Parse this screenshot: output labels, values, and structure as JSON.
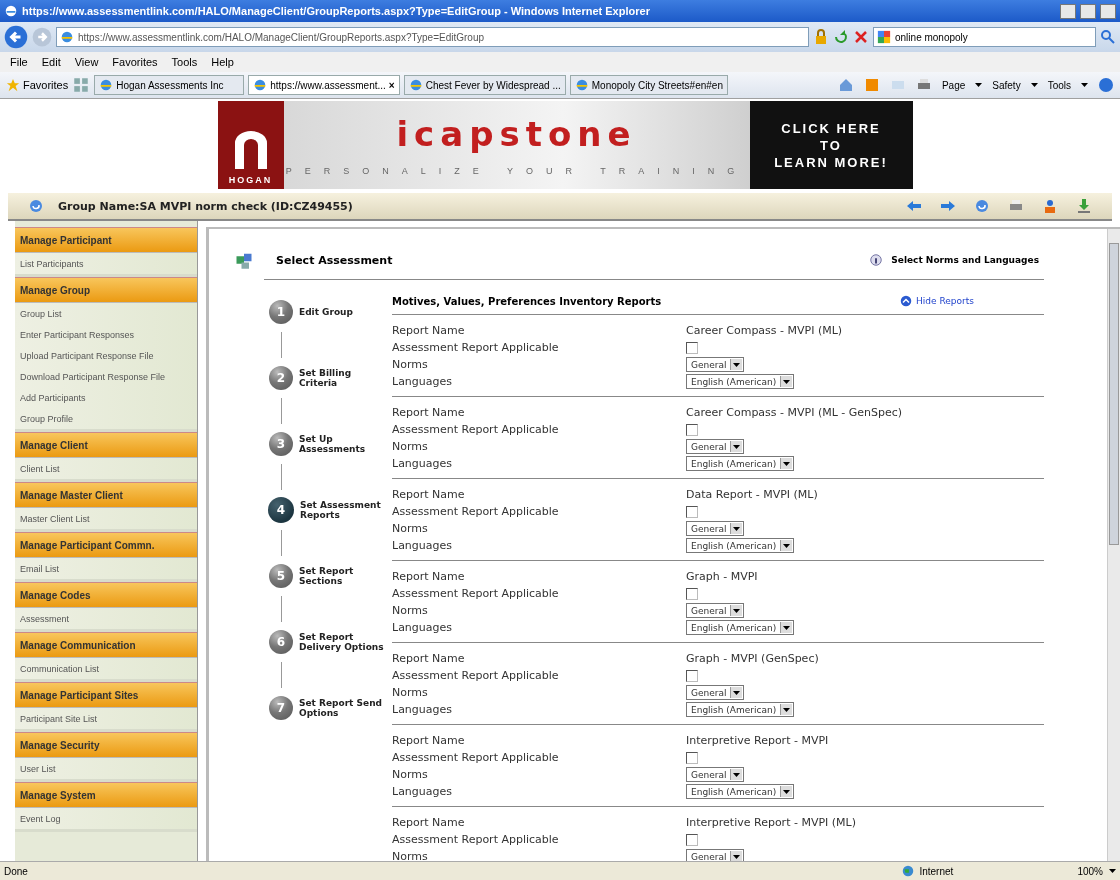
{
  "browser": {
    "title": "https://www.assessmentlink.com/HALO/ManageClient/GroupReports.aspx?Type=EditGroup - Windows Internet Explorer",
    "address": "https://www.assessmentlink.com/HALO/ManageClient/GroupReports.aspx?Type=EditGroup",
    "search": "online monopoly",
    "menu": [
      "File",
      "Edit",
      "View",
      "Favorites",
      "Tools",
      "Help"
    ],
    "favorites": "Favorites",
    "tabs": [
      {
        "label": "Hogan Assessments Inc",
        "selected": false
      },
      {
        "label": "https://www.assessment...",
        "selected": true,
        "close": "×"
      },
      {
        "label": "Chest Fever by Widespread ...",
        "selected": false
      },
      {
        "label": "Monopoly City Streets#en#en",
        "selected": false
      }
    ],
    "command_bar": [
      "Page",
      "Safety",
      "Tools"
    ],
    "status": "Done",
    "zone": "Internet",
    "zoom": "100%"
  },
  "banner": {
    "logo": "HOGAN",
    "title": "icapstone",
    "tagline": "PERSONALIZE YOUR TRAINING",
    "cta": [
      "CLICK HERE",
      "TO",
      "LEARN MORE!"
    ]
  },
  "group_bar": {
    "title": "Group Name:SA MVPI norm check (ID:CZ49455)"
  },
  "sidebar": {
    "sections": [
      {
        "title": "Manage Participant",
        "items": [
          "List Participants"
        ]
      },
      {
        "title": "Manage Group",
        "items": [
          "Group List",
          "Enter Participant Responses",
          "Upload Participant Response File",
          "Download Participant Response File",
          "Add Participants",
          "Group Profile"
        ]
      },
      {
        "title": "Manage Client",
        "items": [
          "Client List"
        ]
      },
      {
        "title": "Manage Master Client",
        "items": [
          "Master Client List"
        ]
      },
      {
        "title": "Manage Participant Commn.",
        "items": [
          "Email List"
        ]
      },
      {
        "title": "Manage Codes",
        "items": [
          "Assessment"
        ]
      },
      {
        "title": "Manage Communication",
        "items": [
          "Communication List"
        ]
      },
      {
        "title": "Manage Participant Sites",
        "items": [
          "Participant Site List"
        ]
      },
      {
        "title": "Manage Security",
        "items": [
          "User List"
        ]
      },
      {
        "title": "Manage System",
        "items": [
          "Event Log"
        ]
      }
    ]
  },
  "content": {
    "title": "Select Assessment",
    "help_link": "Select Norms and Languages",
    "steps": [
      {
        "number": "1",
        "label": "Edit Group",
        "selected": false
      },
      {
        "number": "2",
        "label": "Set Billing\nCriteria",
        "selected": false
      },
      {
        "number": "3",
        "label": "Set Up\nAssessments",
        "selected": false
      },
      {
        "number": "4",
        "label": "Set Assessment\nReports",
        "selected": true
      },
      {
        "number": "5",
        "label": "Set Report\nSections",
        "selected": false
      },
      {
        "number": "6",
        "label": "Set Report\nDelivery Options",
        "selected": false
      },
      {
        "number": "7",
        "label": "Set Report Send\nOptions",
        "selected": false
      }
    ],
    "section_title": "Motives, Values, Preferences Inventory Reports",
    "toggle": "Hide Reports",
    "reports": [
      {
        "labels": [
          "Report Name",
          "Assessment Report Applicable",
          "Norms",
          "Languages"
        ],
        "name": "Career Compass - MVPI (ML)",
        "checked": false,
        "norms": "General",
        "language": "English (American)"
      },
      {
        "labels": [
          "Report Name",
          "Assessment Report Applicable",
          "Norms",
          "Languages"
        ],
        "name": "Career Compass - MVPI (ML - GenSpec)",
        "checked": false,
        "norms": "General",
        "language": "English (American)"
      },
      {
        "labels": [
          "Report Name",
          "Assessment Report Applicable",
          "Norms",
          "Languages"
        ],
        "name": "Data Report - MVPI (ML)",
        "checked": false,
        "norms": "General",
        "language": "English (American)"
      },
      {
        "labels": [
          "Report Name",
          "Assessment Report Applicable",
          "Norms",
          "Languages"
        ],
        "name": "Graph - MVPI",
        "checked": false,
        "norms": "General",
        "language": "English (American)"
      },
      {
        "labels": [
          "Report Name",
          "Assessment Report Applicable",
          "Norms",
          "Languages"
        ],
        "name": "Graph - MVPI (GenSpec)",
        "checked": false,
        "norms": "General",
        "language": "English (American)"
      },
      {
        "labels": [
          "Report Name",
          "Assessment Report Applicable",
          "Norms",
          "Languages"
        ],
        "name": "Interpretive Report - MVPI",
        "checked": false,
        "norms": "General",
        "language": "English (American)"
      },
      {
        "labels": [
          "Report Name",
          "Assessment Report Applicable",
          "Norms"
        ],
        "name": "Interpretive Report - MVPI (ML)",
        "checked": false,
        "norms": "General"
      }
    ]
  }
}
